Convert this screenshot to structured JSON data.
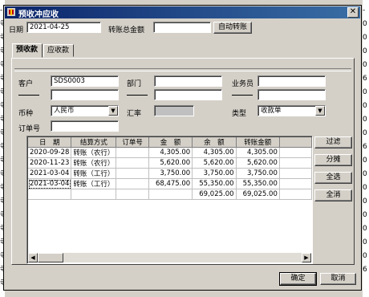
{
  "window": {
    "title": "预收冲应收",
    "close_glyph": "✕"
  },
  "header": {
    "date_label": "日期",
    "date_value": "2021-04-25",
    "total_label": "转账总金额",
    "total_value": "",
    "auto_button": "自动转账"
  },
  "tabs": [
    {
      "label": "预收款",
      "active": true
    },
    {
      "label": "应收款",
      "active": false
    }
  ],
  "form": {
    "customer_label": "客户",
    "customer_value": "SDS0003",
    "dept_label": "部门",
    "dept_value": "",
    "staff_label": "业务员",
    "staff_value": "",
    "currency_label": "币种",
    "currency_value": "人民币",
    "rate_label": "汇率",
    "rate_value": "",
    "type_label": "类型",
    "type_value": "收款单",
    "order_label": "订单号",
    "order_value": ""
  },
  "grid": {
    "columns": [
      "日　期",
      "结算方式",
      "订单号",
      "金　额",
      "余　额",
      "转账金额"
    ],
    "rows": [
      [
        "2020-09-28",
        "转账（农行）",
        "",
        "4,305.00",
        "4,305.00",
        "4,305.00"
      ],
      [
        "2020-11-23",
        "转账（农行）",
        "",
        "5,620.00",
        "5,620.00",
        "5,620.00"
      ],
      [
        "2021-03-04",
        "转账（工行）",
        "",
        "3,750.00",
        "3,750.00",
        "3,750.00"
      ],
      [
        "2021-03-04",
        "转账（工行）",
        "",
        "68,475.00",
        "55,350.00",
        "55,350.00"
      ],
      [
        "",
        "",
        "",
        "",
        "69,025.00",
        "69,025.00"
      ]
    ],
    "scroll_left": "◀",
    "scroll_right": "▶"
  },
  "side_buttons": [
    "过滤",
    "分摊",
    "全选",
    "全消"
  ],
  "footer": {
    "ok": "确定",
    "cancel": "取消"
  },
  "background": {
    "left_chars": [
      "-",
      "寺",
      "寺",
      "寺",
      "寺",
      "寺",
      "寺",
      "寺",
      "寺",
      "寺",
      "寺",
      "寺",
      "寺",
      "寺",
      "寺",
      "寺",
      "寺",
      "寺",
      "寺",
      "寺",
      "寺"
    ],
    "right_chars": [
      "-",
      "0",
      "0",
      "0",
      "0",
      "6",
      "0",
      "0",
      "0",
      "0",
      "6",
      "0",
      "0",
      "0",
      "0",
      "0",
      "0",
      "0",
      "0",
      "6"
    ]
  }
}
